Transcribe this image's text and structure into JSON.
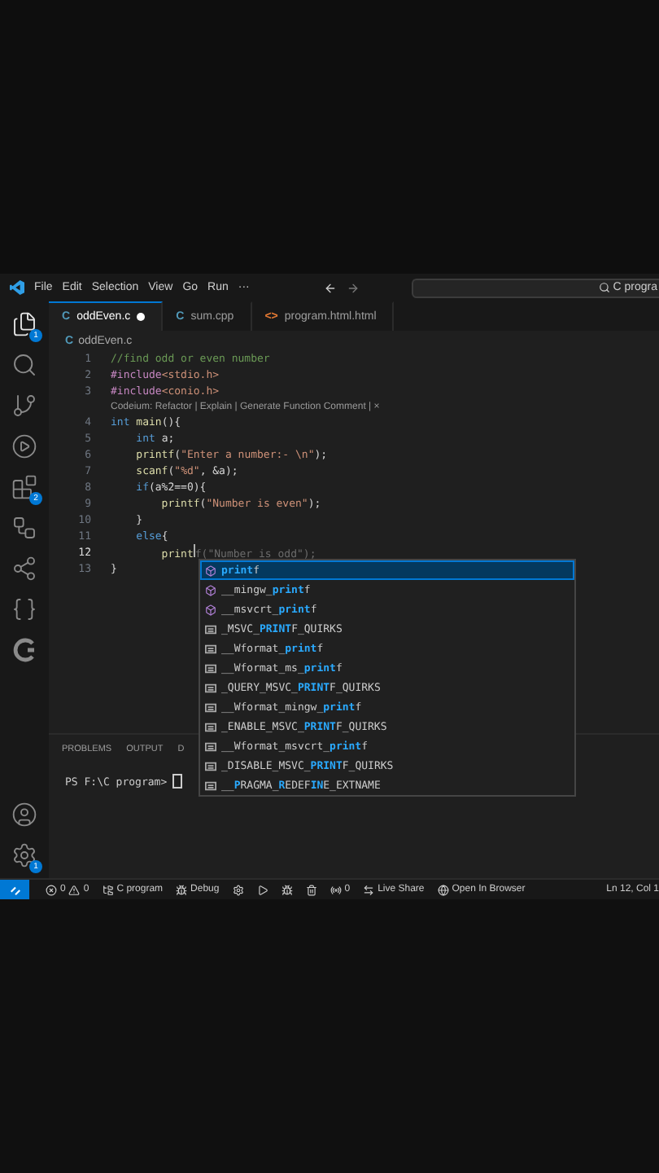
{
  "menu": [
    "File",
    "Edit",
    "Selection",
    "View",
    "Go",
    "Run",
    "···"
  ],
  "search": {
    "value": "C progra"
  },
  "activity": [
    {
      "kind": "files",
      "badge": "1",
      "selected": true
    },
    {
      "kind": "search",
      "selected": false
    },
    {
      "kind": "git",
      "selected": false
    },
    {
      "kind": "debug",
      "selected": false
    },
    {
      "kind": "extensions",
      "badge": "2",
      "selected": false
    },
    {
      "kind": "graph",
      "selected": false
    },
    {
      "kind": "share",
      "selected": false
    },
    {
      "kind": "braces",
      "selected": false
    },
    {
      "kind": "codeium",
      "selected": false
    }
  ],
  "activity_bottom": [
    {
      "kind": "account"
    },
    {
      "kind": "settings",
      "badge": "1"
    }
  ],
  "tabs": [
    {
      "icon": "C",
      "color": "#519aba",
      "label": "oddEven.c",
      "selected": true,
      "modified": true
    },
    {
      "icon": "C",
      "color": "#519aba",
      "label": "sum.cpp",
      "selected": false,
      "modified": false
    },
    {
      "icon": "<>",
      "color": "#e37933",
      "label": "program.html.html",
      "selected": false,
      "modified": false
    }
  ],
  "breadcrumb": {
    "icon": "C",
    "label": "oddEven.c"
  },
  "code": [
    {
      "number": "1",
      "current": false,
      "segments": [
        {
          "kind": "comment",
          "text": "//find odd or even number"
        }
      ]
    },
    {
      "number": "2",
      "current": false,
      "segments": [
        {
          "kind": "preproc",
          "text": "#include"
        },
        {
          "kind": "string",
          "text": "<stdio.h>"
        }
      ]
    },
    {
      "number": "3",
      "current": false,
      "segments": [
        {
          "kind": "preproc",
          "text": "#include"
        },
        {
          "kind": "string",
          "text": "<conio.h>"
        }
      ]
    },
    {
      "lens": "Codeium: Refactor | Explain | Generate Function Comment | ×"
    },
    {
      "number": "4",
      "current": false,
      "segments": [
        {
          "kind": "keyword",
          "text": "int "
        },
        {
          "kind": "function",
          "text": "main"
        },
        {
          "kind": "plain",
          "text": "(){"
        }
      ]
    },
    {
      "number": "5",
      "current": false,
      "segments": [
        {
          "kind": "keyword",
          "text": "    int "
        },
        {
          "kind": "plain",
          "text": "a;"
        }
      ]
    },
    {
      "number": "6",
      "current": false,
      "segments": [
        {
          "kind": "function",
          "text": "    printf"
        },
        {
          "kind": "plain",
          "text": "("
        },
        {
          "kind": "string",
          "text": "\"Enter a number:- \\n\""
        },
        {
          "kind": "plain",
          "text": ");"
        }
      ]
    },
    {
      "number": "7",
      "current": false,
      "segments": [
        {
          "kind": "function",
          "text": "    scanf"
        },
        {
          "kind": "plain",
          "text": "("
        },
        {
          "kind": "string",
          "text": "\"%d\""
        },
        {
          "kind": "plain",
          "text": ", &a);"
        }
      ]
    },
    {
      "number": "8",
      "current": false,
      "segments": [
        {
          "kind": "keyword",
          "text": "    if"
        },
        {
          "kind": "plain",
          "text": "(a%2==0){"
        }
      ]
    },
    {
      "number": "9",
      "current": false,
      "segments": [
        {
          "kind": "function",
          "text": "        printf"
        },
        {
          "kind": "plain",
          "text": "("
        },
        {
          "kind": "string",
          "text": "\"Number is even\""
        },
        {
          "kind": "plain",
          "text": ");"
        }
      ]
    },
    {
      "number": "10",
      "current": false,
      "segments": [
        {
          "kind": "plain",
          "text": "    }"
        }
      ]
    },
    {
      "number": "11",
      "current": false,
      "segments": [
        {
          "kind": "keyword",
          "text": "    else"
        },
        {
          "kind": "plain",
          "text": "{"
        }
      ]
    },
    {
      "number": "12",
      "current": true,
      "segments": [
        {
          "kind": "function",
          "text": "        print"
        },
        {
          "kind": "cursor"
        },
        {
          "kind": "ghost",
          "text": "f(\"Number is odd\");"
        }
      ]
    },
    {
      "number": "13",
      "current": false,
      "segments": [
        {
          "kind": "plain",
          "text": "}"
        }
      ]
    }
  ],
  "suggestions": [
    {
      "kind": "function",
      "selected": true,
      "parts": [
        {
          "text": "print",
          "match": true
        },
        {
          "text": "f",
          "match": false
        }
      ]
    },
    {
      "kind": "function",
      "selected": false,
      "parts": [
        {
          "text": "__mingw_",
          "match": false
        },
        {
          "text": "print",
          "match": true
        },
        {
          "text": "f",
          "match": false
        }
      ]
    },
    {
      "kind": "function",
      "selected": false,
      "parts": [
        {
          "text": "__msvcrt_",
          "match": false
        },
        {
          "text": "print",
          "match": true
        },
        {
          "text": "f",
          "match": false
        }
      ]
    },
    {
      "kind": "constant",
      "selected": false,
      "parts": [
        {
          "text": "_MSVC_",
          "match": false
        },
        {
          "text": "PRINT",
          "match": true
        },
        {
          "text": "F_QUIRKS",
          "match": false
        }
      ]
    },
    {
      "kind": "constant",
      "selected": false,
      "parts": [
        {
          "text": "__Wformat_",
          "match": false
        },
        {
          "text": "print",
          "match": true
        },
        {
          "text": "f",
          "match": false
        }
      ]
    },
    {
      "kind": "constant",
      "selected": false,
      "parts": [
        {
          "text": "__Wformat_ms_",
          "match": false
        },
        {
          "text": "print",
          "match": true
        },
        {
          "text": "f",
          "match": false
        }
      ]
    },
    {
      "kind": "constant",
      "selected": false,
      "parts": [
        {
          "text": "_QUERY_MSVC_",
          "match": false
        },
        {
          "text": "PRINT",
          "match": true
        },
        {
          "text": "F_QUIRKS",
          "match": false
        }
      ]
    },
    {
      "kind": "constant",
      "selected": false,
      "parts": [
        {
          "text": "__Wformat_mingw_",
          "match": false
        },
        {
          "text": "print",
          "match": true
        },
        {
          "text": "f",
          "match": false
        }
      ]
    },
    {
      "kind": "constant",
      "selected": false,
      "parts": [
        {
          "text": "_ENABLE_MSVC_",
          "match": false
        },
        {
          "text": "PRINT",
          "match": true
        },
        {
          "text": "F_QUIRKS",
          "match": false
        }
      ]
    },
    {
      "kind": "constant",
      "selected": false,
      "parts": [
        {
          "text": "__Wformat_msvcrt_",
          "match": false
        },
        {
          "text": "print",
          "match": true
        },
        {
          "text": "f",
          "match": false
        }
      ]
    },
    {
      "kind": "constant",
      "selected": false,
      "parts": [
        {
          "text": "_DISABLE_MSVC_",
          "match": false
        },
        {
          "text": "PRINT",
          "match": true
        },
        {
          "text": "F_QUIRKS",
          "match": false
        }
      ]
    },
    {
      "kind": "constant",
      "selected": false,
      "parts": [
        {
          "text": "__",
          "match": false
        },
        {
          "text": "P",
          "match": true
        },
        {
          "text": "RAGMA_",
          "match": false
        },
        {
          "text": "R",
          "match": true
        },
        {
          "text": "EDEF",
          "match": false
        },
        {
          "text": "IN",
          "match": true
        },
        {
          "text": "E_EXTNAME",
          "match": false
        }
      ]
    }
  ],
  "panel_tabs": [
    {
      "label": "PROBLEMS",
      "selected": false
    },
    {
      "label": "OUTPUT",
      "selected": false
    },
    {
      "label": "D",
      "selected": false
    }
  ],
  "terminal": {
    "prompt": "PS F:\\C program>"
  },
  "status": [
    {
      "kind": "problems",
      "errors": "0",
      "warnings": "0"
    },
    {
      "kind": "folder",
      "text": "C program"
    },
    {
      "kind": "debug",
      "text": "Debug"
    },
    {
      "kind": "gear"
    },
    {
      "kind": "run"
    },
    {
      "kind": "bug"
    },
    {
      "kind": "trash"
    },
    {
      "kind": "ports",
      "text": "0"
    },
    {
      "kind": "liveshare",
      "text": "Live Share"
    },
    {
      "kind": "browser",
      "text": "Open In Browser"
    },
    {
      "kind": "position",
      "text": "Ln 12, Col 1"
    }
  ]
}
